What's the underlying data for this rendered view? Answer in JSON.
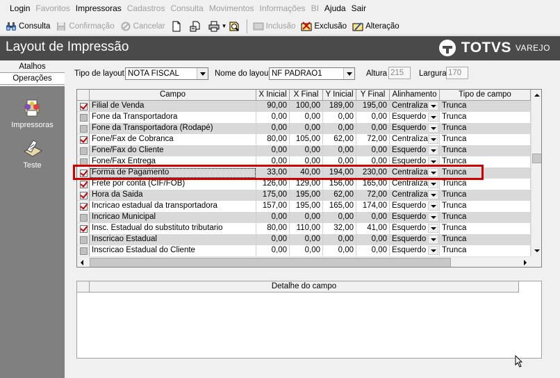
{
  "menu": {
    "items": [
      {
        "label": "Login",
        "enabled": true
      },
      {
        "label": "Favoritos",
        "enabled": false
      },
      {
        "label": "Impressoras",
        "enabled": true
      },
      {
        "label": "Cadastros",
        "enabled": false
      },
      {
        "label": "Consulta",
        "enabled": false
      },
      {
        "label": "Movimentos",
        "enabled": false
      },
      {
        "label": "Informações",
        "enabled": false
      },
      {
        "label": "BI",
        "enabled": false
      },
      {
        "label": "Ajuda",
        "enabled": true
      },
      {
        "label": "Sair",
        "enabled": true
      }
    ]
  },
  "toolbar": {
    "consulta_label": "Consulta",
    "confirmacao_label": "Confirmação",
    "cancelar_label": "Cancelar",
    "inclusao_label": "Inclusão",
    "exclusao_label": "Exclusão",
    "alteracao_label": "Alteração"
  },
  "header": {
    "title": "Layout de Impressão",
    "brand_name": "TOTVS",
    "brand_sub": "VAREJO",
    "background": "#4a4a4a"
  },
  "sidebar": {
    "tabs": [
      {
        "label": "Atalhos",
        "selected": false
      },
      {
        "label": "Operações",
        "selected": true
      }
    ],
    "items": [
      {
        "label": "Impressoras",
        "icon": "printers-icon"
      },
      {
        "label": "Teste",
        "icon": "test-document-icon"
      }
    ]
  },
  "form": {
    "tipo_layout_label": "Tipo de layout",
    "tipo_layout_value": "NOTA FISCAL",
    "nome_layout_label": "Nome do layout",
    "nome_layout_value": "NF PADRAO1",
    "altura_label": "Altura",
    "altura_value": "215",
    "largura_label": "Largura",
    "largura_value": "170"
  },
  "grid": {
    "columns": [
      "Campo",
      "X Inicial",
      "X Final",
      "Y Inicial",
      "Y Final",
      "Alinhamento",
      "Tipo de campo"
    ],
    "rows": [
      {
        "checked": true,
        "campo": "Filial de Venda",
        "x_ini": "90,00",
        "x_fim": "100,00",
        "y_ini": "189,00",
        "y_fim": "195,00",
        "alinhamento": "Centralizad",
        "tipo": "Trunca",
        "shade": "gray"
      },
      {
        "checked": false,
        "campo": "Fone da Transportadora",
        "x_ini": "0,00",
        "x_fim": "0,00",
        "y_ini": "0,00",
        "y_fim": "0,00",
        "alinhamento": "Esquerdo",
        "tipo": "Trunca",
        "shade": "white"
      },
      {
        "checked": false,
        "campo": "Fone da Transportadora (Rodapé)",
        "x_ini": "0,00",
        "x_fim": "0,00",
        "y_ini": "0,00",
        "y_fim": "0,00",
        "alinhamento": "Esquerdo",
        "tipo": "Trunca",
        "shade": "gray"
      },
      {
        "checked": true,
        "campo": "Fone/Fax de Cobranca",
        "x_ini": "80,00",
        "x_fim": "105,00",
        "y_ini": "62,00",
        "y_fim": "72,00",
        "alinhamento": "Centralizad",
        "tipo": "Trunca",
        "shade": "white"
      },
      {
        "checked": false,
        "campo": "Fone/Fax do Cliente",
        "x_ini": "0,00",
        "x_fim": "0,00",
        "y_ini": "0,00",
        "y_fim": "0,00",
        "alinhamento": "Esquerdo",
        "tipo": "Trunca",
        "shade": "gray"
      },
      {
        "checked": false,
        "campo": "Fone/Fax Entrega",
        "x_ini": "0,00",
        "x_fim": "0,00",
        "y_ini": "0,00",
        "y_fim": "0,00",
        "alinhamento": "Esquerdo",
        "tipo": "Trunca",
        "shade": "white"
      },
      {
        "checked": true,
        "campo": "Forma de Pagamento",
        "x_ini": "33,00",
        "x_fim": "40,00",
        "y_ini": "194,00",
        "y_fim": "230,00",
        "alinhamento": "Centralizad",
        "tipo": "Trunca",
        "shade": "gray",
        "selected": true
      },
      {
        "checked": true,
        "campo": "Frete por conta (CIF/FOB)",
        "x_ini": "126,00",
        "x_fim": "129,00",
        "y_ini": "156,00",
        "y_fim": "165,00",
        "alinhamento": "Centralizad",
        "tipo": "Trunca",
        "shade": "white"
      },
      {
        "checked": true,
        "campo": "Hora da Saida",
        "x_ini": "175,00",
        "x_fim": "195,00",
        "y_ini": "62,00",
        "y_fim": "72,00",
        "alinhamento": "Centralizad",
        "tipo": "Trunca",
        "shade": "gray"
      },
      {
        "checked": true,
        "campo": "Incricao estadual da transportadora",
        "x_ini": "157,00",
        "x_fim": "195,00",
        "y_ini": "165,00",
        "y_fim": "174,00",
        "alinhamento": "Esquerdo",
        "tipo": "Trunca",
        "shade": "white"
      },
      {
        "checked": false,
        "campo": "Incricao Municipal",
        "x_ini": "0,00",
        "x_fim": "0,00",
        "y_ini": "0,00",
        "y_fim": "0,00",
        "alinhamento": "Esquerdo",
        "tipo": "Trunca",
        "shade": "gray"
      },
      {
        "checked": true,
        "campo": "Insc. Estadual do substituto tributario",
        "x_ini": "80,00",
        "x_fim": "110,00",
        "y_ini": "32,00",
        "y_fim": "41,00",
        "alinhamento": "Esquerdo",
        "tipo": "Trunca",
        "shade": "white"
      },
      {
        "checked": false,
        "campo": "Inscricao Estadual",
        "x_ini": "0,00",
        "x_fim": "0,00",
        "y_ini": "0,00",
        "y_fim": "0,00",
        "alinhamento": "Esquerdo",
        "tipo": "Trunca",
        "shade": "gray"
      },
      {
        "checked": false,
        "campo": "Inscricao Estadual  do Cliente",
        "x_ini": "0,00",
        "x_fim": "0,00",
        "y_ini": "0,00",
        "y_fim": "0,00",
        "alinhamento": "Esquerdo",
        "tipo": "Trunca",
        "shade": "white"
      }
    ]
  },
  "detail": {
    "header": "Detalhe do campo"
  },
  "colors": {
    "highlight": "#d00000",
    "check": "#c00000",
    "row_gray": "#d9d9d9"
  }
}
